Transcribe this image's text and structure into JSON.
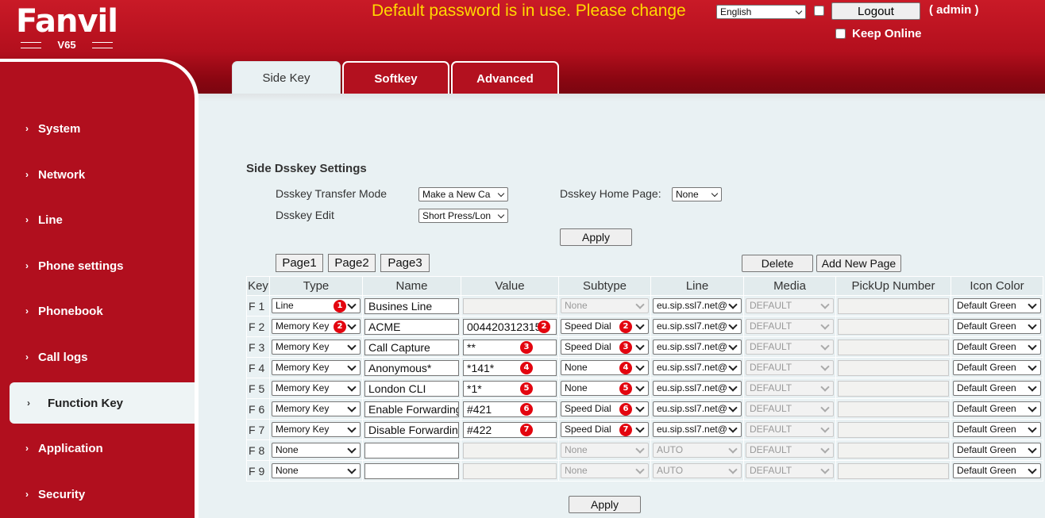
{
  "header": {
    "logo_text": "Fanvil",
    "model": "V65",
    "warning": "Default password is in use. Please change",
    "language": "English",
    "logout_label": "Logout",
    "user": "( admin )",
    "keep_online_label": "Keep Online"
  },
  "tabs": [
    {
      "label": "Side Key",
      "active": true
    },
    {
      "label": "Softkey",
      "active": false
    },
    {
      "label": "Advanced",
      "active": false
    }
  ],
  "sidebar": {
    "items": [
      {
        "label": "System"
      },
      {
        "label": "Network"
      },
      {
        "label": "Line"
      },
      {
        "label": "Phone settings"
      },
      {
        "label": "Phonebook"
      },
      {
        "label": "Call logs"
      },
      {
        "label": "Function Key",
        "active": true
      },
      {
        "label": "Application"
      },
      {
        "label": "Security"
      }
    ]
  },
  "settings": {
    "title": "Side Dsskey Settings",
    "transfer_mode_label": "Dsskey Transfer Mode",
    "transfer_mode_value": "Make a New Ca",
    "home_page_label": "Dsskey Home Page:",
    "home_page_value": "None",
    "edit_label": "Dsskey Edit",
    "edit_value": "Short Press/Lon",
    "apply_label": "Apply"
  },
  "pages": {
    "page1": "Page1",
    "page2": "Page2",
    "page3": "Page3",
    "delete_label": "Delete",
    "add_page_label": "Add New Page"
  },
  "table": {
    "headers": [
      "Key",
      "Type",
      "Name",
      "Value",
      "Subtype",
      "Line",
      "Media",
      "PickUp Number",
      "Icon Color"
    ],
    "rows": [
      {
        "key": "F 1",
        "type": "Line",
        "name": "Busines Line",
        "value": "",
        "subtype": "None",
        "line": "eu.sip.ssl7.net@",
        "media": "DEFAULT",
        "pickup": "",
        "color": "Default Green",
        "badge": "1"
      },
      {
        "key": "F 2",
        "type": "Memory Key",
        "name": "ACME",
        "value": "004420312315",
        "subtype": "Speed Dial",
        "line": "eu.sip.ssl7.net@",
        "media": "DEFAULT",
        "pickup": "",
        "color": "Default Green",
        "badge": "2"
      },
      {
        "key": "F 3",
        "type": "Memory Key",
        "name": "Call Capture",
        "value": "**",
        "subtype": "Speed Dial",
        "line": "eu.sip.ssl7.net@",
        "media": "DEFAULT",
        "pickup": "",
        "color": "Default Green",
        "badge": "3"
      },
      {
        "key": "F 4",
        "type": "Memory Key",
        "name": "Anonymous*",
        "value": "*141*",
        "subtype": "None",
        "line": "eu.sip.ssl7.net@",
        "media": "DEFAULT",
        "pickup": "",
        "color": "Default Green",
        "badge": "4"
      },
      {
        "key": "F 5",
        "type": "Memory Key",
        "name": "London CLI",
        "value": "*1*",
        "subtype": "None",
        "line": "eu.sip.ssl7.net@",
        "media": "DEFAULT",
        "pickup": "",
        "color": "Default Green",
        "badge": "5"
      },
      {
        "key": "F 6",
        "type": "Memory Key",
        "name": "Enable Forwarding",
        "value": "#421",
        "subtype": "Speed Dial",
        "line": "eu.sip.ssl7.net@",
        "media": "DEFAULT",
        "pickup": "",
        "color": "Default Green",
        "badge": "6"
      },
      {
        "key": "F 7",
        "type": "Memory Key",
        "name": "Disable Forwarding",
        "value": "#422",
        "subtype": "Speed Dial",
        "line": "eu.sip.ssl7.net@",
        "media": "DEFAULT",
        "pickup": "",
        "color": "Default Green",
        "badge": "7"
      },
      {
        "key": "F 8",
        "type": "None",
        "name": "",
        "value": "",
        "subtype": "None",
        "line": "AUTO",
        "media": "DEFAULT",
        "pickup": "",
        "color": "Default Green",
        "badge": ""
      },
      {
        "key": "F 9",
        "type": "None",
        "name": "",
        "value": "",
        "subtype": "None",
        "line": "AUTO",
        "media": "DEFAULT",
        "pickup": "",
        "color": "Default Green",
        "badge": ""
      }
    ]
  },
  "footer_apply_label": "Apply",
  "colors": {
    "brand_red": "#b10f1e",
    "warning_yellow": "#ffd900",
    "badge_red": "#e3050f",
    "content_bg": "#e9f1f3"
  }
}
